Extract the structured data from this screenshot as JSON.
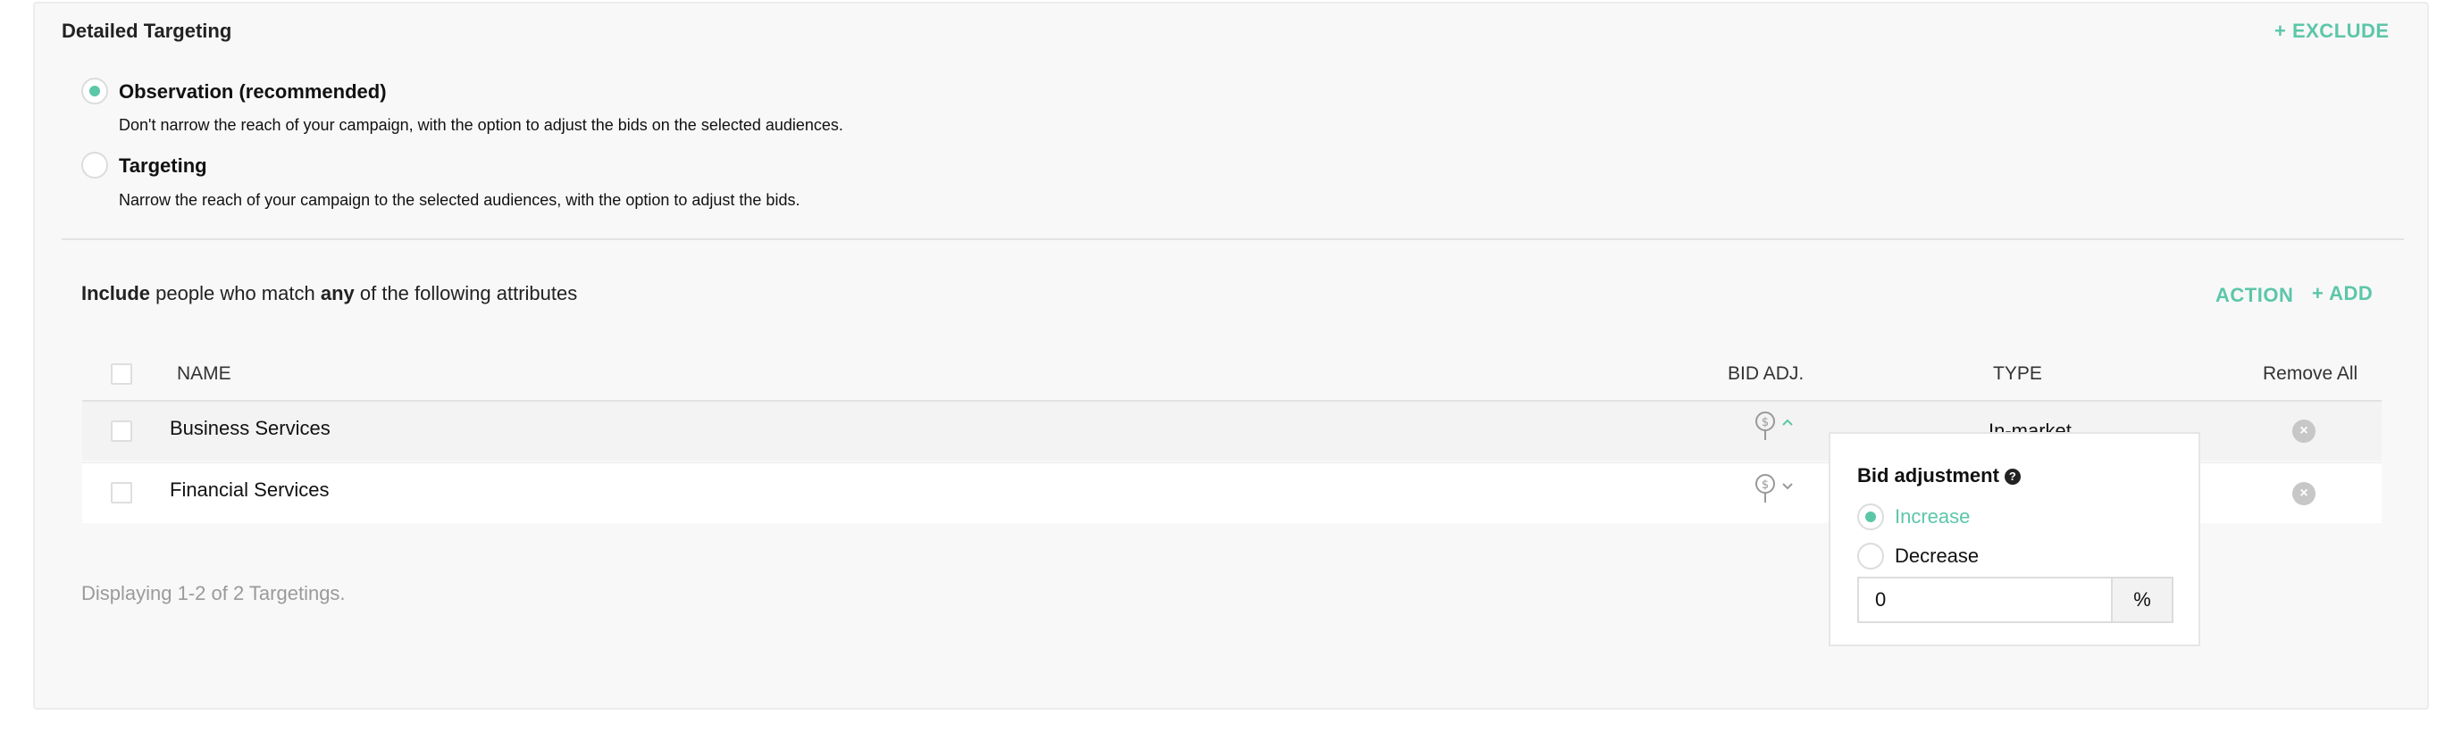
{
  "section": {
    "title": "Detailed Targeting",
    "exclude_label": "+ EXCLUDE"
  },
  "options": [
    {
      "label": "Observation (recommended)",
      "description": "Don't narrow the reach of your campaign, with the option to adjust the bids on the selected audiences.",
      "selected": true
    },
    {
      "label": "Targeting",
      "description": "Narrow the reach of your campaign to the selected audiences, with the option to adjust the bids.",
      "selected": false
    }
  ],
  "include": {
    "word_include": "Include",
    "text_middle": "people who match",
    "word_any": "any",
    "text_end": "of the following attributes",
    "action_label": "ACTION",
    "add_label": "+ ADD"
  },
  "table": {
    "headers": {
      "name": "NAME",
      "bid_adj": "BID ADJ.",
      "type": "TYPE",
      "remove_all": "Remove All"
    },
    "rows": [
      {
        "name": "Business Services",
        "type": "In-market",
        "expanded": true
      },
      {
        "name": "Financial Services",
        "type": "",
        "expanded": false
      }
    ],
    "footer": "Displaying 1-2 of 2 Targetings."
  },
  "popover": {
    "title": "Bid adjustment",
    "options": [
      "Increase",
      "Decrease"
    ],
    "selected": "Increase",
    "value": "0",
    "unit": "%"
  },
  "colors": {
    "accent": "#5cc6a8",
    "panel_bg": "#f8f8f8",
    "muted_text": "#9a9a9a"
  },
  "icons": {
    "pin": "dollar-pin-icon",
    "remove": "remove-circle-icon",
    "help": "question-circle-icon"
  }
}
